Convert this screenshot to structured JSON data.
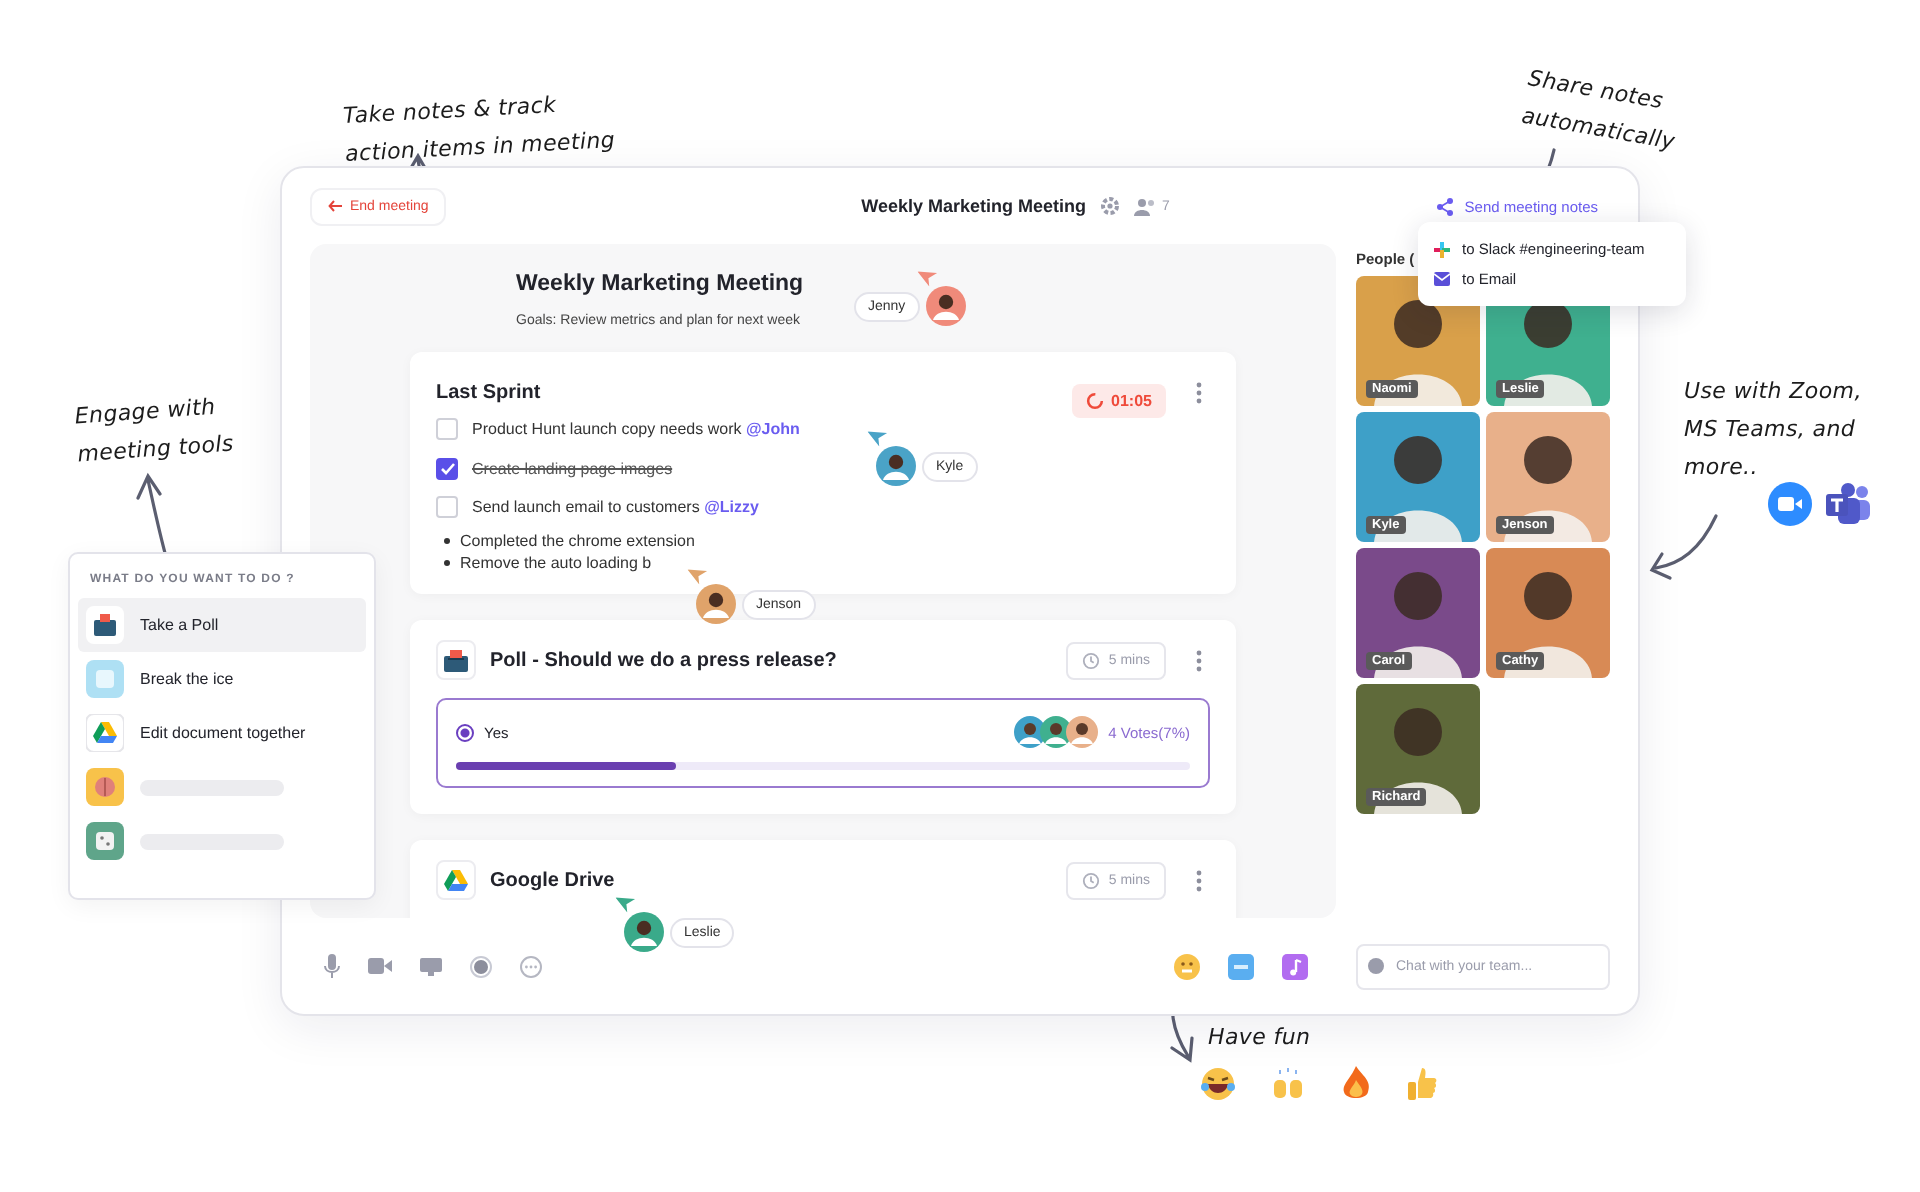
{
  "annotations": [
    {
      "kind": "notes",
      "lines": [
        "Take notes & track",
        "action items in meeting"
      ]
    },
    {
      "kind": "share",
      "lines": [
        "Share notes",
        "automatically"
      ]
    },
    {
      "kind": "tools",
      "lines": [
        "Engage with",
        "meeting tools"
      ]
    },
    {
      "kind": "integrations",
      "lines": [
        "Use with Zoom,",
        "MS Teams, and",
        "more.."
      ]
    },
    {
      "kind": "fun",
      "lines": [
        "Have fun"
      ]
    }
  ],
  "header": {
    "back": "End meeting",
    "title": "Weekly Marketing Meeting",
    "count": "7",
    "share": "Send meeting notes",
    "share_menu": [
      {
        "kind": "slack",
        "label": "to Slack #engineering-team"
      },
      {
        "kind": "email",
        "label": "to Email"
      }
    ]
  },
  "doc": {
    "title": "Weekly Marketing Meeting",
    "goals": "Goals: Review metrics and plan for next week"
  },
  "sprint": {
    "title": "Last Sprint",
    "timer": "01:05",
    "tasks": [
      {
        "text": "Product Hunt launch copy needs work",
        "mention": "@John",
        "checked": false
      },
      {
        "text": "Create landing page images",
        "checked": true
      },
      {
        "text": "Send launch email to customers",
        "mention": "@Lizzy",
        "checked": false
      }
    ],
    "bullets": [
      "Completed the chrome extension",
      "Remove the auto loading b"
    ]
  },
  "poll": {
    "title": "Poll - Should we do a press release?",
    "duration": "5 mins",
    "options": [
      {
        "label": "Yes",
        "selected": true,
        "votes": "4 Votes(7%)",
        "level": 0.3
      }
    ]
  },
  "drive": {
    "title": "Google Drive",
    "duration": "5 mins"
  },
  "cursors": [
    {
      "name": "Jenny",
      "color": "#f08a7a"
    },
    {
      "name": "Kyle",
      "color": "#4aa3c7"
    },
    {
      "name": "Jenson",
      "color": "#e0a36a"
    },
    {
      "name": "Leslie",
      "color": "#3aaa8a"
    }
  ],
  "people": {
    "label": "People (",
    "list": [
      {
        "name": "Naomi",
        "color": "#d9a04a"
      },
      {
        "name": "Leslie",
        "color": "#3fb08f"
      },
      {
        "name": "Kyle",
        "color": "#3ea0c8"
      },
      {
        "name": "Jenson",
        "color": "#e8b08a"
      },
      {
        "name": "Carol",
        "color": "#7a4a8a"
      },
      {
        "name": "Cathy",
        "color": "#d88a55"
      },
      {
        "name": "Richard",
        "color": "#5f6a3a"
      }
    ]
  },
  "chat": {
    "placeholder": "Chat with your team..."
  },
  "tools": {
    "heading": "WHAT DO YOU WANT TO DO ?",
    "items": [
      {
        "kind": "poll",
        "label": "Take a Poll",
        "selected": true
      },
      {
        "kind": "ice",
        "label": "Break the ice",
        "selected": false
      },
      {
        "kind": "drive",
        "label": "Edit document together",
        "selected": false
      },
      {
        "kind": "brain",
        "selected": false
      },
      {
        "kind": "dice",
        "selected": false
      }
    ]
  }
}
